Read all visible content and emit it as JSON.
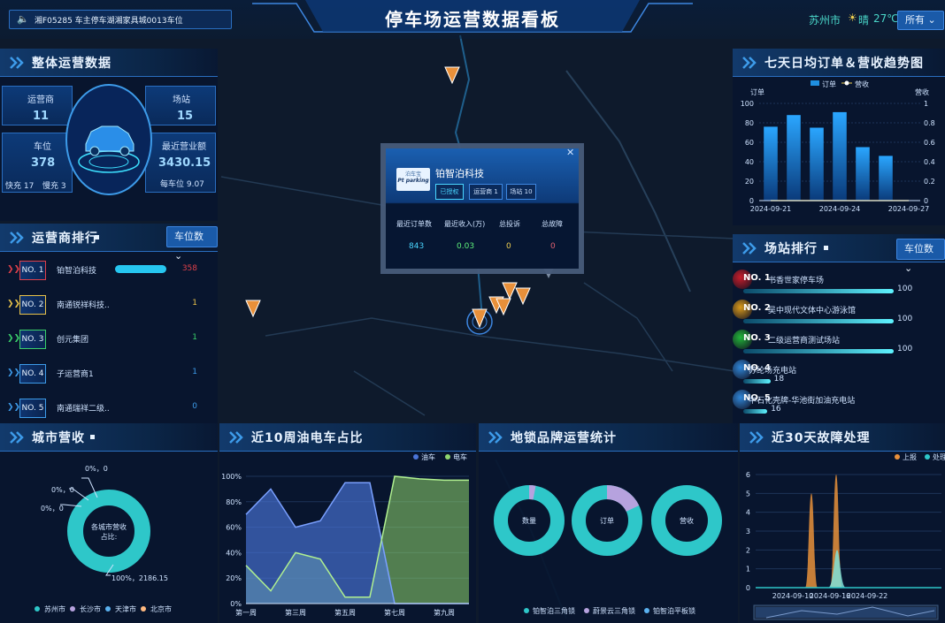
{
  "header": {
    "title": "停车场运营数据看板",
    "notice": "湘F05285 车主停车湖湘家具城0013车位",
    "city": "苏州市",
    "weather": "晴",
    "temp": "27℃",
    "filter": "所有"
  },
  "overview": {
    "title": "整体运营数据",
    "operators_label": "运营商",
    "operators": "11",
    "sites_label": "场站",
    "sites": "15",
    "spaces_label": "车位",
    "spaces": "378",
    "revenue_label": "最近营业额",
    "revenue": "3430.15",
    "fast": "快充 17",
    "slow": "慢充 3",
    "per_space": "每车位 9.07"
  },
  "operator_rank": {
    "title": "运营商排行",
    "select": "车位数",
    "items": [
      {
        "no": "NO. 1",
        "name": "铂智泊科技",
        "value": "358",
        "color": "#e0404a"
      },
      {
        "no": "NO. 2",
        "name": "南通锐祥科技...",
        "value": "1",
        "color": "#e8c24a"
      },
      {
        "no": "NO. 3",
        "name": "创元集团",
        "value": "1",
        "color": "#3ad06a"
      },
      {
        "no": "NO. 4",
        "name": "子运营商1",
        "value": "1",
        "color": "#3d9be9"
      },
      {
        "no": "NO. 5",
        "name": "南通瑞祥二级...",
        "value": "0",
        "color": "#3d9be9"
      }
    ]
  },
  "trend": {
    "title": "七天日均订单＆营收趋势图",
    "legend_orders": "订单",
    "legend_revenue": "营收",
    "ylabel_left": "订单",
    "ylabel_right": "营收"
  },
  "site_rank": {
    "title": "场站排行",
    "select": "车位数",
    "items": [
      {
        "no": "NO. 1",
        "name": "书香世家停车场",
        "value": "100",
        "ratio": 1.0,
        "color": "#c81e2c"
      },
      {
        "no": "NO. 2",
        "name": "吴中现代文体中心游泳馆",
        "value": "100",
        "ratio": 1.0,
        "color": "#d99a1c"
      },
      {
        "no": "NO. 3",
        "name": "二级运营商测试场站",
        "value": "100",
        "ratio": 1.0,
        "color": "#22b53a"
      },
      {
        "no": "NO. 4",
        "name": "苏纶场充电站",
        "value": "18",
        "ratio": 0.18,
        "color": "#2f86d8"
      },
      {
        "no": "NO. 5",
        "name": "中石化壳牌-华池街加油充电站",
        "value": "16",
        "ratio": 0.16,
        "color": "#2f86d8"
      }
    ]
  },
  "popup": {
    "logo_top": "泊车宝",
    "logo_bottom": "Pt parking",
    "company": "铂智泊科技",
    "tag1": "已授权",
    "tag2": "运营商 1",
    "tag3": "场站 10",
    "h1": "最近订单数",
    "h2": "最近收入(万)",
    "h3": "总投诉",
    "h4": "总故障",
    "v1": "843",
    "v2": "0.03",
    "v3": "0",
    "v4": "0"
  },
  "city_revenue": {
    "title": "城市营收",
    "center1": "各城市营收",
    "center2": "占比:",
    "l1": "0%，0",
    "l2": "0%，0",
    "l3": "0%，0",
    "l4": "100%，2186.15",
    "legend": [
      {
        "name": "苏州市",
        "color": "#2ec7c9"
      },
      {
        "name": "长沙市",
        "color": "#b6a2de"
      },
      {
        "name": "天津市",
        "color": "#5ab1ef"
      },
      {
        "name": "北京市",
        "color": "#ffb980"
      }
    ]
  },
  "ev_share": {
    "title": "近10周油电车占比",
    "legend_oil": "油车",
    "legend_ev": "电车"
  },
  "brand": {
    "title": "地锁品牌运营统计",
    "d1": "数量",
    "d2": "订单",
    "d3": "营收",
    "legend": [
      {
        "name": "铂智泊三角锁",
        "color": "#2ec7c9"
      },
      {
        "name": "蔚景云三角锁",
        "color": "#b6a2de"
      },
      {
        "name": "铂智泊平板锁",
        "color": "#5ab1ef"
      }
    ]
  },
  "fault": {
    "title": "近30天故障处理",
    "legend_report": "上报",
    "legend_handle": "处理"
  },
  "colors": {
    "accent": "#2a6ec0",
    "cyan": "#2ec7c9",
    "bar": "#1f8fe0",
    "oil": "#4a74d8",
    "ev": "#8fd66e",
    "orange": "#e8903a"
  },
  "chart_data": [
    {
      "type": "bar",
      "title": "七天日均订单＆营收趋势图",
      "categories": [
        "2024-09-21",
        "2024-09-22",
        "2024-09-23",
        "2024-09-24",
        "2024-09-25",
        "2024-09-26",
        "2024-09-27"
      ],
      "series": [
        {
          "name": "订单",
          "values": [
            76,
            88,
            75,
            91,
            55,
            46,
            0
          ]
        },
        {
          "name": "营收",
          "values": [
            0,
            0,
            0,
            0,
            0,
            0,
            0
          ]
        }
      ],
      "ylabel": "订单",
      "ylim": [
        0,
        100
      ],
      "y2label": "营收",
      "y2lim": [
        0,
        1
      ],
      "yticks": [
        "0",
        "20",
        "40",
        "60",
        "80",
        "100"
      ],
      "y2ticks": [
        "0",
        "0.2",
        "0.4",
        "0.6",
        "0.8",
        "1"
      ],
      "xticks": [
        "2024-09-21",
        "2024-09-24",
        "2024-09-27"
      ]
    },
    {
      "type": "area",
      "title": "近10周油电车占比",
      "categories": [
        "第一周",
        "第二周",
        "第三周",
        "第四周",
        "第五周",
        "第六周",
        "第七周",
        "第八周",
        "第九周",
        "第十周"
      ],
      "series": [
        {
          "name": "油车",
          "values": [
            70,
            90,
            60,
            65,
            95,
            95,
            0,
            0,
            0,
            0
          ]
        },
        {
          "name": "电车",
          "values": [
            30,
            10,
            40,
            35,
            5,
            5,
            100,
            98,
            97,
            97
          ]
        }
      ],
      "ylim": [
        0,
        100
      ],
      "yticks": [
        "0%",
        "20%",
        "40%",
        "60%",
        "80%",
        "100%"
      ],
      "xticks": [
        "第一周",
        "第三周",
        "第五周",
        "第七周",
        "第九周"
      ]
    },
    {
      "type": "pie",
      "title": "城市营收",
      "categories": [
        "苏州市",
        "长沙市",
        "天津市",
        "北京市"
      ],
      "values": [
        2186.15,
        0,
        0,
        0
      ]
    },
    {
      "type": "pie",
      "title": "地锁品牌运营统计",
      "categories": [
        "数量",
        "订单",
        "营收"
      ],
      "series": [
        {
          "name": "铂智泊三角锁",
          "values": [
            97,
            82,
            100
          ]
        },
        {
          "name": "蔚景云三角锁",
          "values": [
            3,
            18,
            0
          ]
        },
        {
          "name": "铂智泊平板锁",
          "values": [
            0,
            0,
            0
          ]
        }
      ]
    },
    {
      "type": "area",
      "title": "近30天故障处理",
      "categories": [
        "2024-09-10",
        "2024-09-16",
        "2024-09-22"
      ],
      "series": [
        {
          "name": "上报",
          "peaks": [
            {
              "date": "2024-09-13",
              "value": 5
            },
            {
              "date": "2024-09-17",
              "value": 6
            }
          ]
        },
        {
          "name": "处理",
          "peaks": [
            {
              "date": "2024-09-17",
              "value": 2
            }
          ]
        }
      ],
      "ylim": [
        0,
        6
      ],
      "yticks": [
        "0",
        "1",
        "2",
        "3",
        "4",
        "5",
        "6"
      ],
      "xticks": [
        "2024-09-10",
        "2024-09-16",
        "2024-09-22"
      ]
    }
  ]
}
